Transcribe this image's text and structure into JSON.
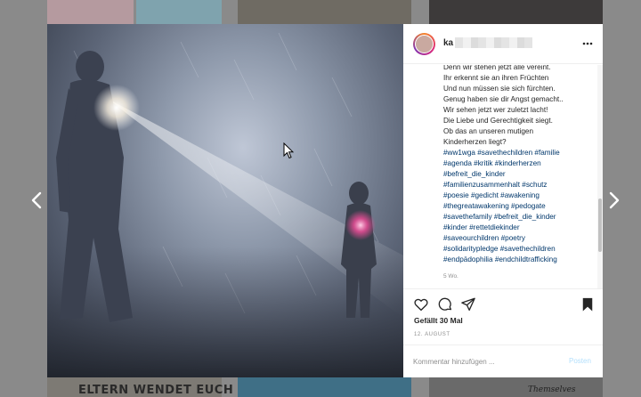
{
  "background": {
    "bottom_left_text": "ELTERN WENDET EUCH",
    "bottom_right_text": "Themselves"
  },
  "post": {
    "author": {
      "username": "ka",
      "username_redacted": true
    },
    "caption_lines": [
      "Denn wir stehen jetzt alle vereint.",
      "Ihr erkennt sie an ihren Früchten",
      "Und nun müssen sie sich fürchten.",
      "Genug haben sie dir Angst gemacht..",
      "Wir sehen jetzt wer zuletzt lacht!",
      "Die Liebe und Gerechtigkeit siegt.",
      "Ob das an unseren mutigen",
      "Kinderherzen liegt?"
    ],
    "hashtag_lines": [
      "#ww1wga #savethechildren #familie",
      "#agenda #kritik #kinderherzen",
      "#befreit_die_kinder",
      "#familienzusammenhalt #schutz",
      "#poesie #gedicht #awakening",
      "#thegreatawakening #pedogate",
      "#savethefamily #befreit_die_kinder",
      "#kinder #rettetdiekinder",
      "#saveourchildren #poetry",
      "#solidaritypledge #savethechildren",
      "#endpädophilia #endchildtrafficking"
    ],
    "time_ago": "5 Wo.",
    "likes": "Gefällt 30 Mal",
    "date": "12. AUGUST",
    "comment_placeholder": "Kommentar hinzufügen ...",
    "post_button": "Posten"
  },
  "icons": {
    "more": "more-horizontal-icon",
    "like": "heart-icon",
    "comment": "comment-icon",
    "share": "share-icon",
    "save": "bookmark-icon",
    "prev": "chevron-left-icon",
    "next": "chevron-right-icon"
  },
  "colors": {
    "hashtag": "#00376b",
    "post_button_disabled": "#b2dffc",
    "overlay": "#8a8a8a"
  }
}
